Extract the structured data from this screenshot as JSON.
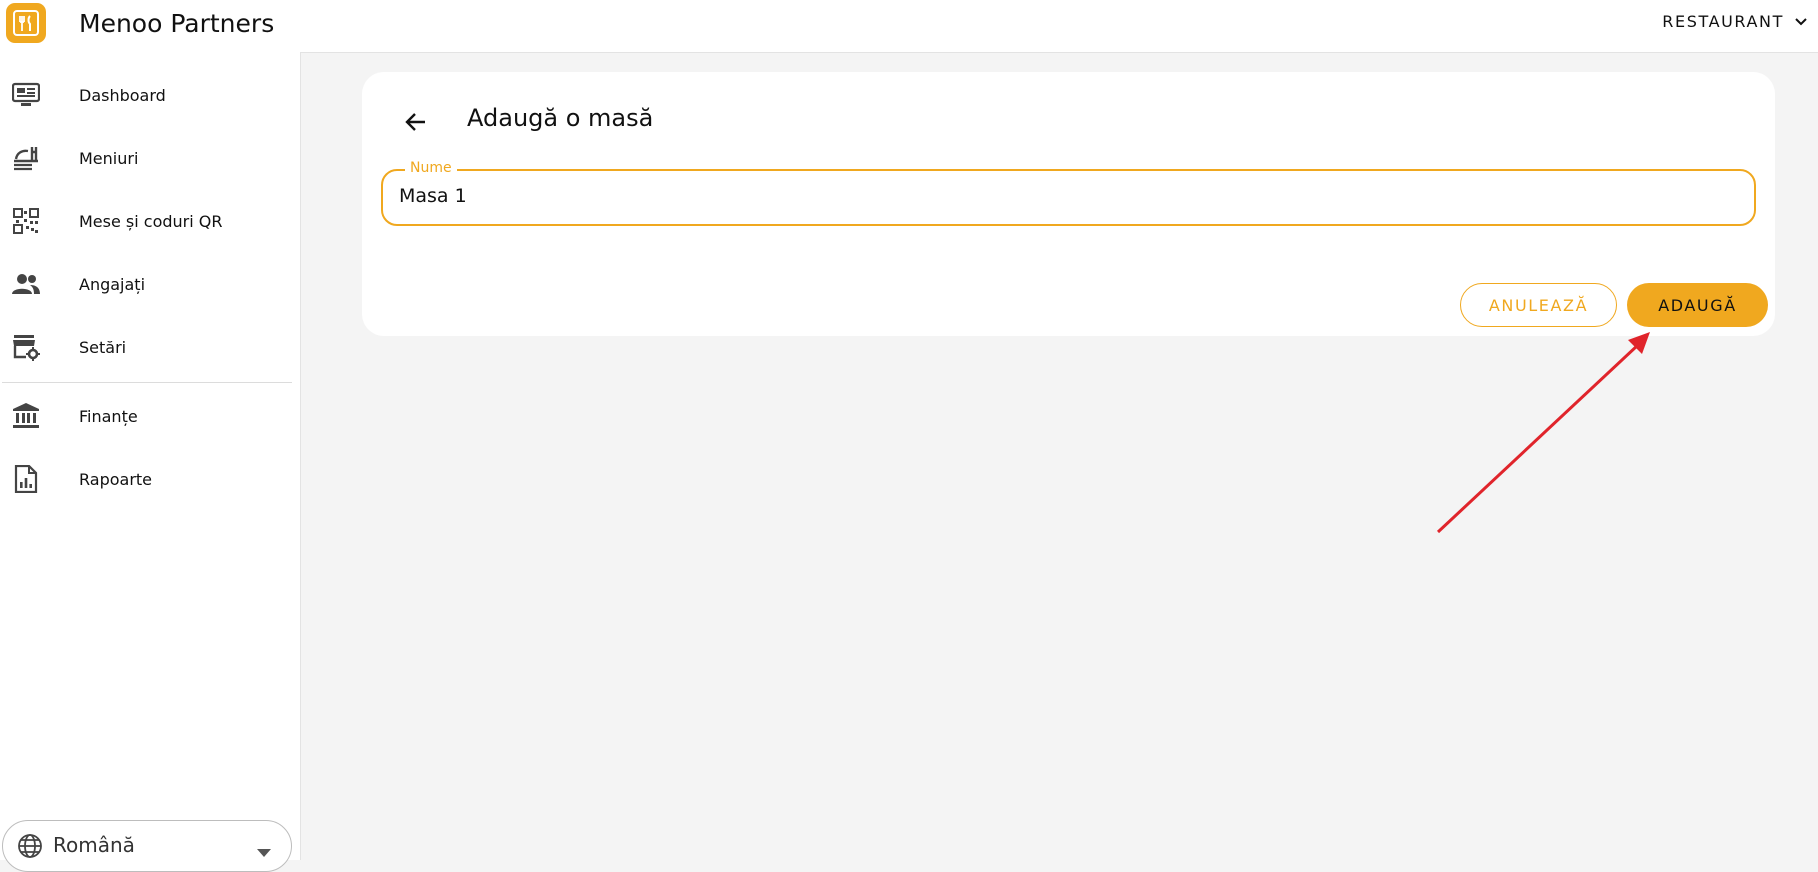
{
  "header": {
    "app_title": "Menoo Partners",
    "restaurant_label": "RESTAURANT",
    "accent_color": "#f0a81f"
  },
  "sidebar": {
    "items": [
      {
        "label": "Dashboard",
        "icon": "monitor-dashboard-icon"
      },
      {
        "label": "Meniuri",
        "icon": "room-service-icon"
      },
      {
        "label": "Mese și coduri QR",
        "icon": "qr-code-icon"
      },
      {
        "label": "Angajați",
        "icon": "people-icon"
      },
      {
        "label": "Setări",
        "icon": "store-settings-icon"
      },
      {
        "label": "Finanțe",
        "icon": "bank-icon"
      },
      {
        "label": "Rapoarte",
        "icon": "report-chart-icon"
      }
    ],
    "language": {
      "label": "Română",
      "icon": "globe-icon"
    }
  },
  "form": {
    "title": "Adaugă o masă",
    "field_label": "Nume",
    "field_value": "Masa 1",
    "cancel_label": "ANULEAZĂ",
    "add_label": "ADAUGĂ"
  },
  "annotation": {
    "color": "#e0242b"
  }
}
